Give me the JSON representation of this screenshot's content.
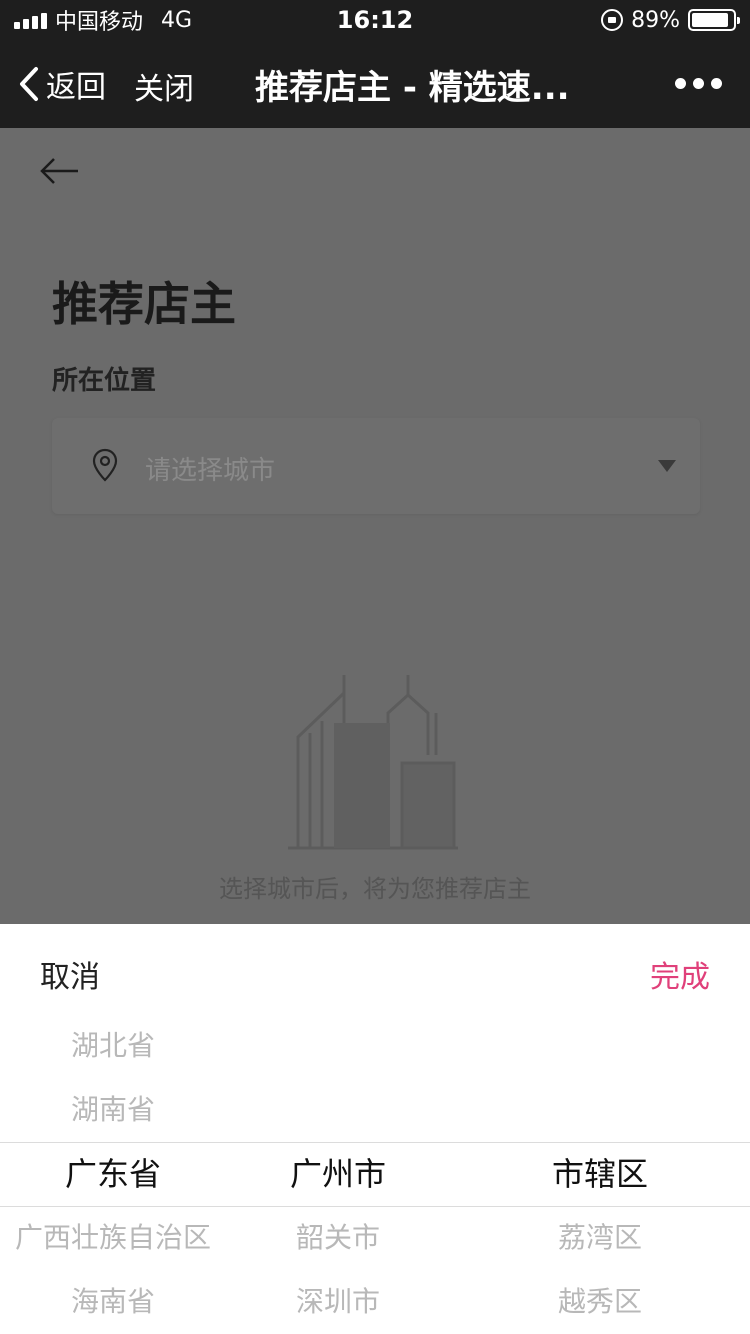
{
  "status_bar": {
    "carrier": "中国移动",
    "network": "4G",
    "time": "16:12",
    "battery": "89%",
    "battery_level": 0.89
  },
  "nav_bar": {
    "back_label": "返回",
    "close_label": "关闭",
    "title": "推荐店主 - 精选速..."
  },
  "page": {
    "title": "推荐店主",
    "location_label": "所在位置",
    "city_placeholder": "请选择城市",
    "empty_hint": "选择城市后，将为您推荐店主"
  },
  "picker": {
    "cancel_label": "取消",
    "done_label": "完成",
    "accent_color": "#e0407a",
    "provinces": [
      "湖北省",
      "湖南省",
      "广东省",
      "广西壮族自治区",
      "海南省"
    ],
    "cities": [
      "广州市",
      "韶关市",
      "深圳市"
    ],
    "districts": [
      "市辖区",
      "荔湾区",
      "越秀区"
    ],
    "selected": {
      "province": "广东省",
      "city": "广州市",
      "district": "市辖区"
    }
  }
}
